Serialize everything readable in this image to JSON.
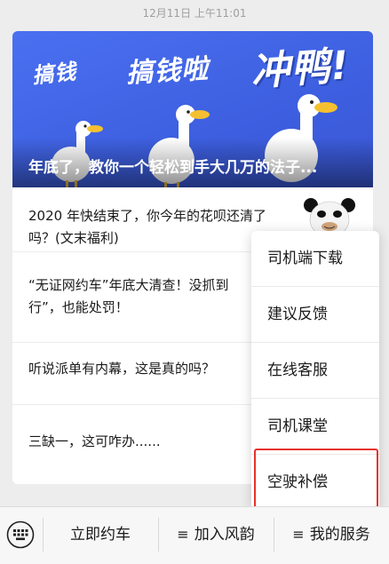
{
  "timestamp": "12月11日 上午11:01",
  "banner": {
    "words": [
      "搞钱",
      "搞钱啦",
      "冲鸭!"
    ],
    "title": "年底了，教你一个轻松到手大几万的法子..."
  },
  "articles": [
    {
      "text_lines": [
        "2020 年快结束了，你今年的花呗还清了",
        "吗？(文末福利)"
      ]
    },
    {
      "text_lines": [
        "“无证网约车”年底大清查！没抓到",
        "行”，也能处罚！"
      ]
    },
    {
      "text_lines": [
        "听说派单有内幕，这是真的吗？"
      ]
    },
    {
      "text_lines": [
        "三缺一，这可咋办......"
      ]
    }
  ],
  "menu": {
    "items": [
      "司机端下载",
      "建议反馈",
      "在线客服",
      "司机课堂",
      "空驶补偿"
    ],
    "highlighted": "空驶补偿",
    "highlight_color": "#e5322c"
  },
  "bottom_bar": {
    "keyboard_icon": "keyboard-icon",
    "buttons": [
      "立即约车",
      "加入风韵",
      "我的服务"
    ],
    "menu_glyph": "≡"
  }
}
